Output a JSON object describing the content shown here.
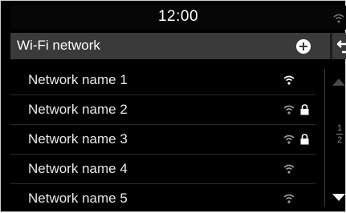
{
  "status": {
    "time": "12:00",
    "wifi_icon": "wifi-icon"
  },
  "header": {
    "title": "Wi-Fi network",
    "add_icon": "plus-circle-icon",
    "back_icon": "back-arrow-icon"
  },
  "networks": [
    {
      "name": "Network name 1",
      "locked": false,
      "signal": "strong"
    },
    {
      "name": "Network name 2",
      "locked": true,
      "signal": "weak"
    },
    {
      "name": "Network name 3",
      "locked": true,
      "signal": "weak"
    },
    {
      "name": "Network name 4",
      "locked": false,
      "signal": "weak"
    },
    {
      "name": "Network name 5",
      "locked": false,
      "signal": "weak"
    }
  ],
  "pager": {
    "current": "1",
    "total": "2"
  },
  "colors": {
    "strong_signal": "#ffffff",
    "weak_signal": "#9a9a9a",
    "background": "#000000",
    "header": "#3a3a3a"
  }
}
